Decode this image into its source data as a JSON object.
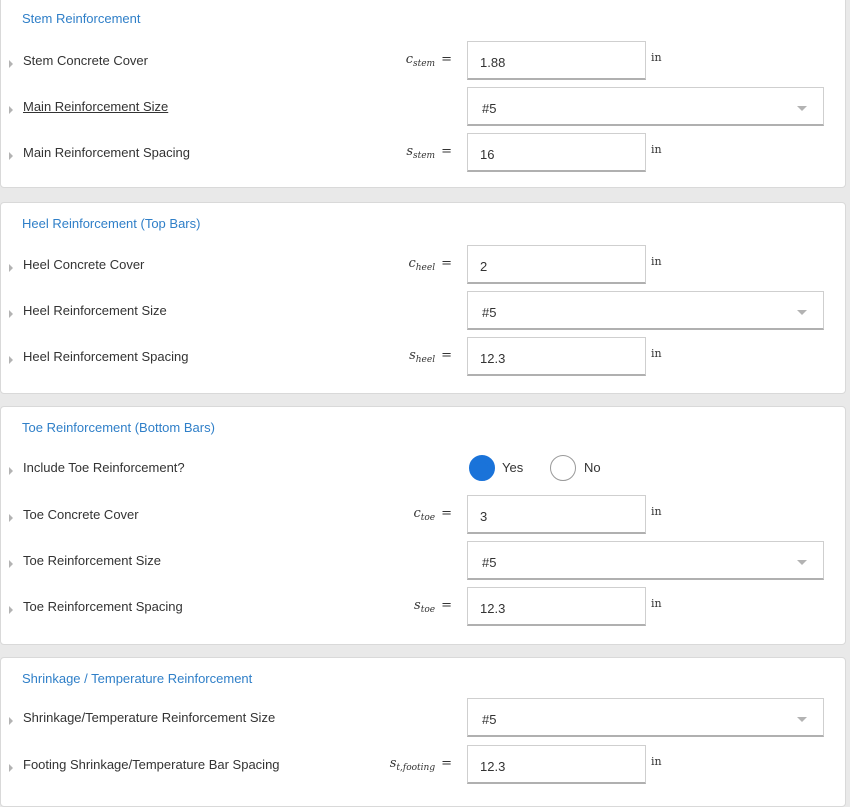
{
  "sections": [
    {
      "title": "Stem Reinforcement",
      "rows": [
        {
          "label": "Stem Concrete Cover",
          "sym_var": "c",
          "sym_sub": "stem",
          "value": "1.88",
          "unit": "in"
        },
        {
          "label": "Main Reinforcement Size",
          "value": "#5"
        },
        {
          "label": "Main Reinforcement Spacing",
          "sym_var": "s",
          "sym_sub": "stem",
          "value": "16",
          "unit": "in"
        }
      ]
    },
    {
      "title": "Heel Reinforcement (Top Bars)",
      "rows": [
        {
          "label": "Heel Concrete Cover",
          "sym_var": "c",
          "sym_sub": "heel",
          "value": "2",
          "unit": "in"
        },
        {
          "label": "Heel Reinforcement Size",
          "value": "#5"
        },
        {
          "label": "Heel Reinforcement Spacing",
          "sym_var": "s",
          "sym_sub": "heel",
          "value": "12.3",
          "unit": "in"
        }
      ]
    },
    {
      "title": "Toe Reinforcement (Bottom Bars)",
      "rows": [
        {
          "label": "Include Toe Reinforcement?",
          "options": [
            "Yes",
            "No"
          ],
          "selected": "Yes"
        },
        {
          "label": "Toe Concrete Cover",
          "sym_var": "c",
          "sym_sub": "toe",
          "value": "3",
          "unit": "in"
        },
        {
          "label": "Toe Reinforcement Size",
          "value": "#5"
        },
        {
          "label": "Toe Reinforcement Spacing",
          "sym_var": "s",
          "sym_sub": "toe",
          "value": "12.3",
          "unit": "in"
        }
      ]
    },
    {
      "title": "Shrinkage / Temperature Reinforcement",
      "rows": [
        {
          "label": "Shrinkage/Temperature Reinforcement Size",
          "value": "#5"
        },
        {
          "label": "Footing Shrinkage/Temperature Bar Spacing",
          "sym_var": "s",
          "sym_sub": "t,footing",
          "value": "12.3",
          "unit": "in"
        }
      ]
    }
  ],
  "eq_sign": "=",
  "icons": {
    "row_expand": "caret-right-icon",
    "dropdown": "chevron-down-icon"
  },
  "colors": {
    "section_title": "#2f7fc8",
    "radio_selected": "#1a73d9"
  }
}
